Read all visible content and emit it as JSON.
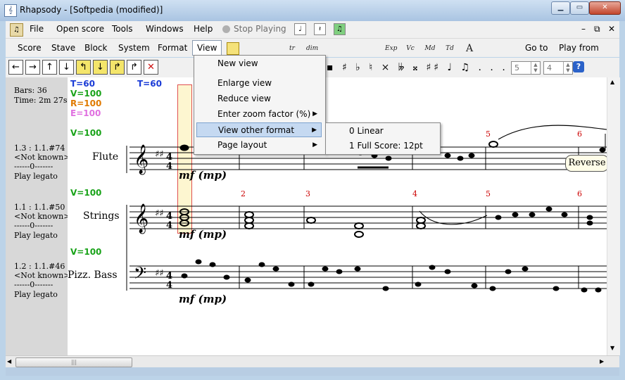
{
  "window": {
    "title": "Rhapsody - [Softpedia (modified)]",
    "app_icon_glyph": "𝄞"
  },
  "menubar": {
    "items": [
      "File",
      "Open score",
      "Tools",
      "Windows",
      "Help"
    ],
    "stop_playing": "Stop Playing"
  },
  "menubar2": {
    "items": [
      "Score",
      "Stave",
      "Block",
      "System",
      "Format",
      "View"
    ],
    "goto": "Go to",
    "playfrom": "Play from",
    "tool_labels": [
      "",
      "",
      "",
      "tr",
      "dim",
      "",
      "",
      "",
      "Exp",
      "Vc",
      "Md",
      "Td",
      "A",
      "",
      "",
      ""
    ]
  },
  "toolbar3": {
    "nav_glyphs": [
      "←",
      "→",
      "↑",
      "↓",
      "↰",
      "↓",
      "↱",
      "↱",
      "✕"
    ],
    "spin1": "5",
    "spin2": "4"
  },
  "left_panel": {
    "bars": "Bars: 36",
    "time": "Time: 2m  27s",
    "staves": [
      {
        "position": "1.3 : 1.1.#74",
        "name": "<Not known>",
        "sep": "------0-------",
        "action": "Play legato"
      },
      {
        "position": "1.1 : 1.1.#50",
        "name": "<Not known>",
        "sep": "------0-------",
        "action": "Play legato"
      },
      {
        "position": "1.2 : 1.1.#46",
        "name": "<Not known>",
        "sep": "------0-------",
        "action": "Play legato"
      }
    ]
  },
  "score": {
    "tempo_marks": [
      {
        "text": "T=60",
        "color": "#1a3bd6"
      },
      {
        "text": "V=100",
        "color": "#1aa31a"
      },
      {
        "text": "R=100",
        "color": "#e07a00"
      },
      {
        "text": "E=100",
        "color": "#e070e0"
      }
    ],
    "tempo2": "T=60",
    "volumes": [
      "V=100",
      "V=100",
      "V=100"
    ],
    "instruments": [
      "Flute",
      "Strings",
      "Pizz. Bass"
    ],
    "dynamics": "mf (mp)",
    "bar_numbers_row1": [
      "5",
      "6"
    ],
    "bar_numbers_row2": [
      "2",
      "3",
      "4",
      "5",
      "6"
    ],
    "tooltip": "Reverse"
  },
  "view_menu": {
    "items": [
      {
        "label": "New view",
        "submenu": false
      },
      {
        "label": "Enlarge view",
        "submenu": false
      },
      {
        "label": "Reduce view",
        "submenu": false
      },
      {
        "label": "Enter zoom factor (%)",
        "submenu": true
      },
      {
        "label": "View other format",
        "submenu": true
      },
      {
        "label": "Page layout",
        "submenu": true
      }
    ]
  },
  "submenu": {
    "items": [
      "0 Linear",
      "1 Full Score: 12pt"
    ]
  },
  "colors": {
    "accent": "#c5d9f1",
    "barnumber": "#c00000"
  }
}
